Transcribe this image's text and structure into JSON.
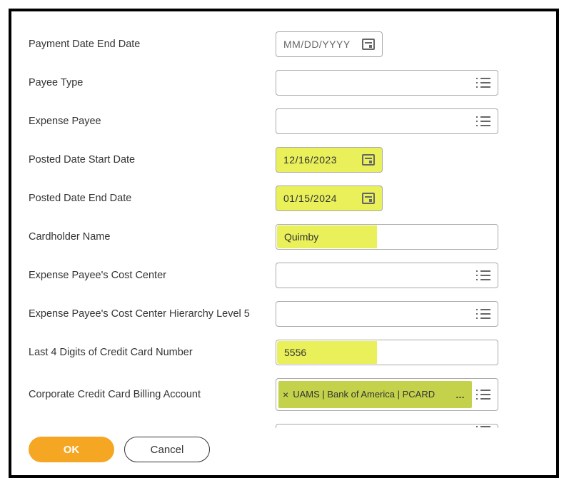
{
  "fields": {
    "payment_date_end": {
      "label": "Payment Date End Date",
      "value": "MM/DD/YYYY"
    },
    "payee_type": {
      "label": "Payee Type"
    },
    "expense_payee": {
      "label": "Expense Payee"
    },
    "posted_start": {
      "label": "Posted Date Start Date",
      "value": "12/16/2023"
    },
    "posted_end": {
      "label": "Posted Date End Date",
      "value": "01/15/2024"
    },
    "cardholder": {
      "label": "Cardholder Name",
      "value": "Quimby"
    },
    "payee_cost_center": {
      "label": "Expense Payee's Cost Center"
    },
    "payee_cc_hier5": {
      "label": "Expense Payee's Cost Center Hierarchy Level 5"
    },
    "last4": {
      "label": "Last 4 Digits of Credit Card Number",
      "value": "5556"
    },
    "billing_account": {
      "label": "Corporate Credit Card Billing Account",
      "chip": "UAMS | Bank of America | PCARD"
    }
  },
  "buttons": {
    "ok": "OK",
    "cancel": "Cancel"
  }
}
